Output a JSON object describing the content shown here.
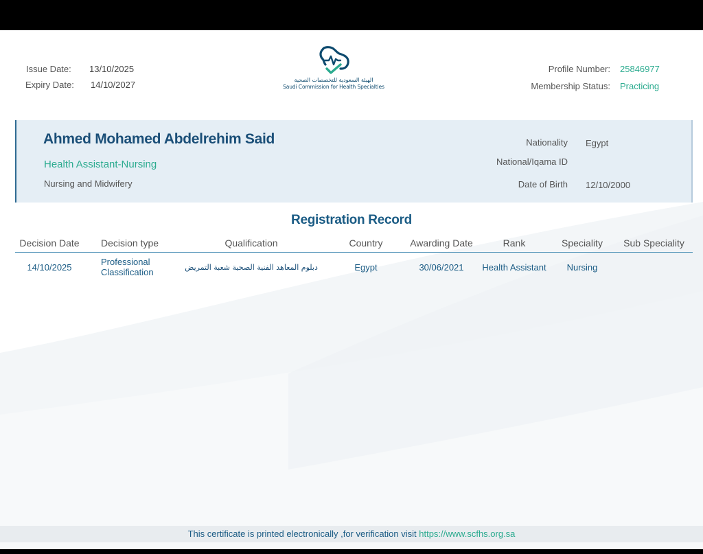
{
  "header": {
    "issue_date_label": "Issue Date:",
    "issue_date": "13/10/2025",
    "expiry_date_label": "Expiry Date:",
    "expiry_date": "14/10/2027",
    "profile_number_label": "Profile Number:",
    "profile_number": "25846977",
    "membership_status_label": "Membership Status:",
    "membership_status": "Practicing"
  },
  "logo": {
    "arabic_name": "الهيئة السعودية للتخصصات الصحية",
    "english_name": "Saudi Commission for Health Specialties",
    "icon": "map-heartbeat-logo-icon",
    "colors": {
      "outline": "#0d4a6e",
      "pulse": "#2bab8f"
    }
  },
  "profile": {
    "name": "Ahmed Mohamed Abdelrehim Said",
    "title": "Health Assistant-Nursing",
    "department": "Nursing and Midwifery",
    "nationality_label": "Nationality",
    "nationality": "Egypt",
    "national_id_label": "National/Iqama ID",
    "dob_label": "Date of Birth",
    "dob": "12/10/2000"
  },
  "registration": {
    "title": "Registration Record",
    "columns": [
      "Decision Date",
      "Decision type",
      "Qualification",
      "Country",
      "Awarding Date",
      "Rank",
      "Speciality",
      "Sub Speciality"
    ],
    "rows": [
      {
        "decision_date": "14/10/2025",
        "decision_type": "Professional Classification",
        "qualification": "دبلوم المعاهد الفنية الصحية شعبة التمريض",
        "country": "Egypt",
        "awarding_date": "30/06/2021",
        "rank": "Health Assistant",
        "speciality": "Nursing",
        "sub_speciality": ""
      }
    ]
  },
  "footer": {
    "text": "This certificate is printed electronically ,for verification visit ",
    "link": "https://www.scfhs.org.sa"
  },
  "colors": {
    "accent_green": "#2bab8f",
    "brand_blue": "#1b5c85",
    "panel_bg": "#e5eef5"
  }
}
